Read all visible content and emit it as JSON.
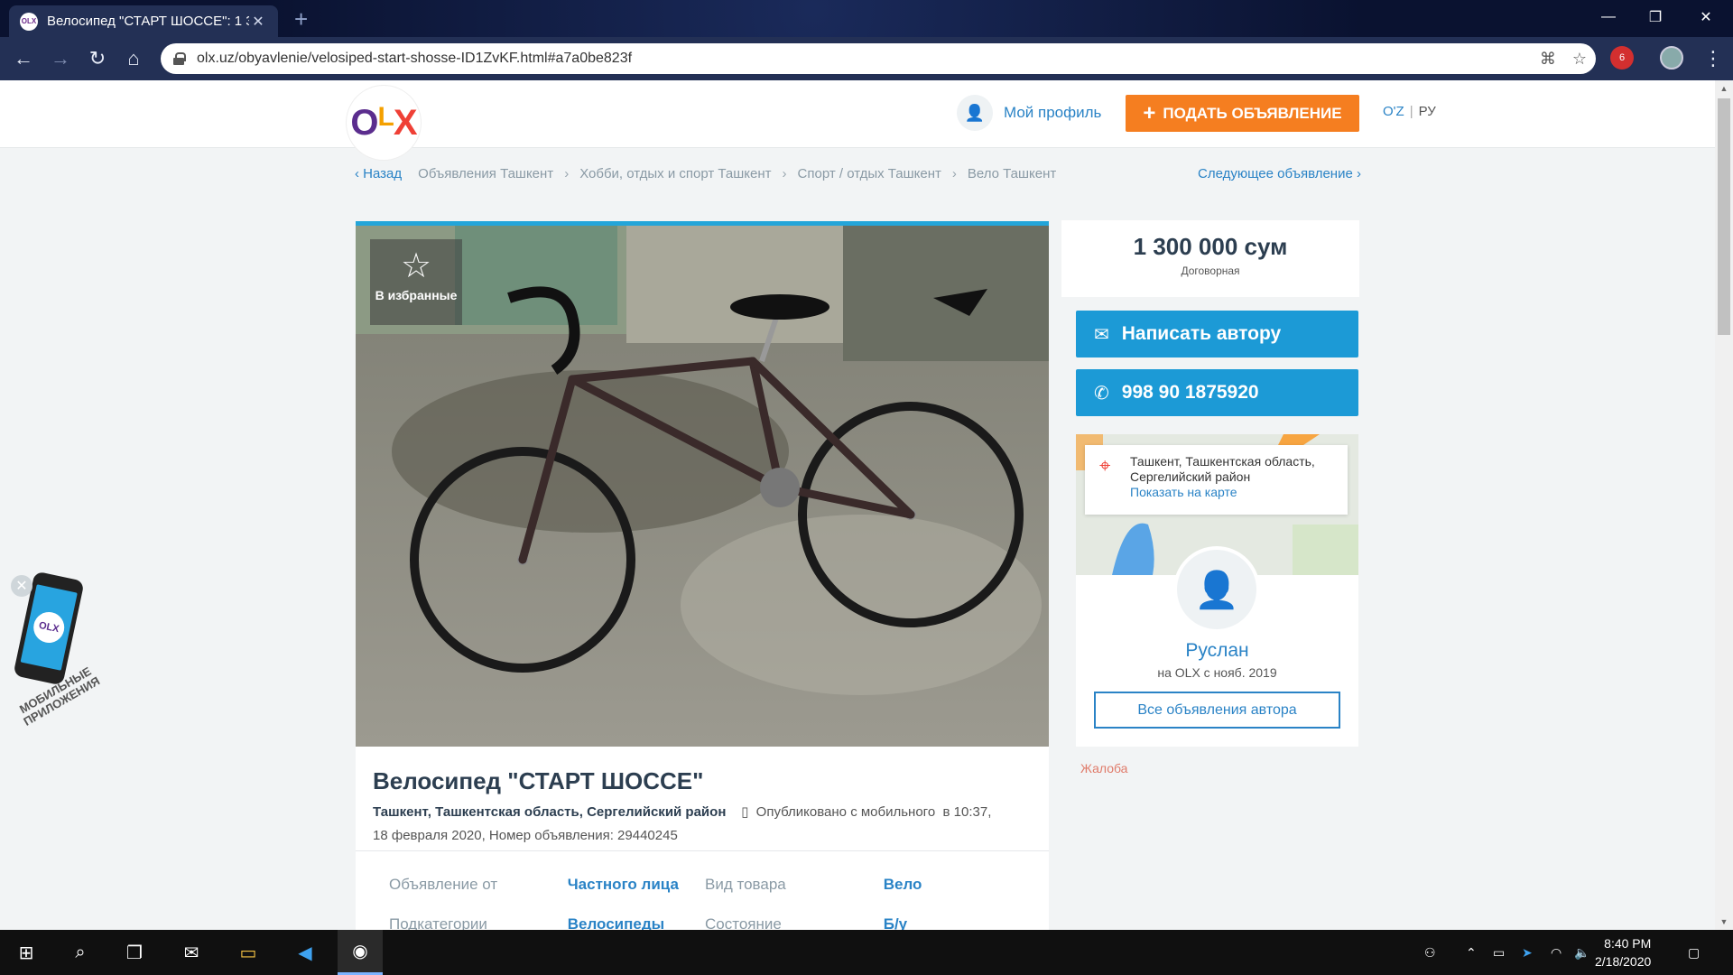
{
  "browser": {
    "tab_title": "Велосипед \"СТАРТ ШОССЕ\": 1 3",
    "tab_favicon": "OLX",
    "url": "olx.uz/obyavlenie/velosiped-start-shosse-ID1ZvKF.html#a7a0be823f",
    "extension_badge": "6"
  },
  "header": {
    "logo": {
      "o": "O",
      "l": "L",
      "x": "X"
    },
    "profile_label": "Мой профиль",
    "post_button_label": "ПОДАТЬ ОБЪЯВЛЕНИЕ",
    "lang_uz": "O'Z",
    "lang_sep": "|",
    "lang_ru": "РУ"
  },
  "breadcrumbs": {
    "back": "Назад",
    "items": [
      "Объявления Ташкент",
      "Хобби, отдых и спорт Ташкент",
      "Спорт / отдых Ташкент",
      "Вело Ташкент"
    ],
    "next": "Следующее объявление"
  },
  "listing": {
    "favorite_label": "В избранные",
    "title": "Велосипед \"СТАРТ ШОССЕ\"",
    "location": "Ташкент, Ташкентская область, Сергелийский район",
    "published": "Опубликовано с мобильного",
    "published_time": "в 10:37,",
    "published_rest": "18 февраля 2020, Номер объявления: 29440245",
    "details": [
      {
        "label": "Объявление от",
        "value": "Частного лица",
        "label2": "Вид товара",
        "value2": "Вело"
      },
      {
        "label": "Подкатегории",
        "value": "Велосипеды",
        "label2": "Состояние",
        "value2": "Б/у"
      }
    ]
  },
  "sidebar": {
    "price": "1 300 000 сум",
    "negotiable": "Договорная",
    "message_button": "Написать автору",
    "phone_button": "998 90 1875920",
    "map_location": "Ташкент, Ташкентская область, Сергелийский район",
    "map_link": "Показать на карте",
    "seller_name": "Руслан",
    "seller_since": "на OLX с нояб. 2019",
    "all_ads": "Все объявления автора",
    "complaint": "Жалоба"
  },
  "promo": {
    "text": "МОБИЛЬНЫЕ ПРИЛОЖЕНИЯ",
    "screen_logo": "OLX"
  },
  "taskbar": {
    "time": "8:40 PM",
    "date": "2/18/2020"
  },
  "colors": {
    "accent_blue": "#2a83c6",
    "button_blue": "#1c9ad6",
    "post_orange": "#f57e20",
    "top_border": "#23a5d9"
  }
}
